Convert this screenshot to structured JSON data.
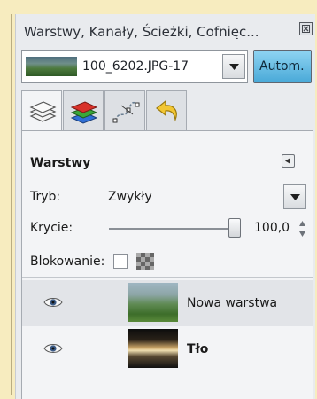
{
  "window": {
    "title": "Warstwy, Kanały, Ścieżki, Cofnięc..."
  },
  "image_selector": {
    "value": "100_6202.JPG-17",
    "auto_label": "Autom."
  },
  "tabs": [
    {
      "icon": "layers-icon",
      "active": true
    },
    {
      "icon": "channels-icon",
      "active": false
    },
    {
      "icon": "paths-icon",
      "active": false
    },
    {
      "icon": "undo-history-icon",
      "active": false
    }
  ],
  "layers_panel": {
    "title": "Warstwy",
    "mode_label": "Tryb:",
    "mode_value": "Zwykły",
    "opacity_label": "Krycie:",
    "opacity_value": "100,0",
    "lock_label": "Blokowanie:"
  },
  "layers": [
    {
      "name": "Nowa warstwa",
      "visible": true,
      "selected": true
    },
    {
      "name": "Tło",
      "visible": true,
      "selected": false
    }
  ],
  "colors": {
    "background": "#f7ecbf",
    "panel": "#e9ebee",
    "auto_button": "#49a9d8"
  }
}
